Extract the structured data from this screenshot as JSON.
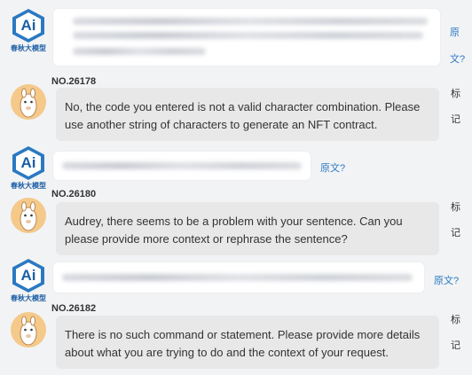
{
  "ai_brand": "春秋大模型",
  "original_link": "原文?",
  "mark_label": [
    "标",
    "记"
  ],
  "messages": [
    {
      "id": "NO.26178",
      "text": "No, the code you entered is not a valid character combination. Please use another string of characters to generate an NFT contract."
    },
    {
      "id": "NO.26180",
      "text": "Audrey, there seems to be a problem with your sentence. Can you please provide more context or rephrase the sentence?"
    },
    {
      "id": "NO.26182",
      "text": "There is no such command or statement. Please provide more details about what you are trying to do and the context of your request."
    }
  ]
}
